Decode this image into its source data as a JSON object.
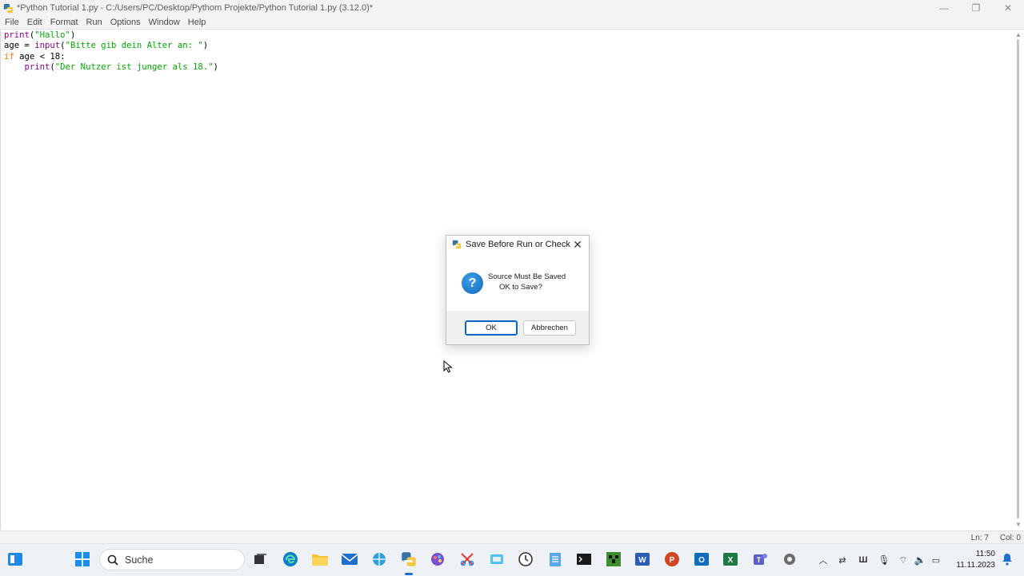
{
  "window": {
    "title": "*Python Tutorial 1.py - C:/Users/PC/Desktop/Pythom Projekte/Python Tutorial 1.py (3.12.0)*",
    "controls": {
      "minimize": "—",
      "restore": "❐",
      "close": "✕"
    }
  },
  "menu": {
    "items": [
      "File",
      "Edit",
      "Format",
      "Run",
      "Options",
      "Window",
      "Help"
    ]
  },
  "editor": {
    "lines": [
      [
        {
          "t": "print",
          "c": "bi"
        },
        {
          "t": "(",
          "c": ""
        },
        {
          "t": "\"Hallo\"",
          "c": "str"
        },
        {
          "t": ")",
          "c": ""
        }
      ],
      [
        {
          "t": "age = ",
          "c": ""
        },
        {
          "t": "input",
          "c": "bi"
        },
        {
          "t": "(",
          "c": ""
        },
        {
          "t": "\"Bitte gib dein Alter an: \"",
          "c": "str"
        },
        {
          "t": ")",
          "c": ""
        }
      ],
      [
        {
          "t": "if",
          "c": "kw"
        },
        {
          "t": " age < 18:",
          "c": ""
        }
      ],
      [
        {
          "t": "    ",
          "c": ""
        },
        {
          "t": "print",
          "c": "bi"
        },
        {
          "t": "(",
          "c": ""
        },
        {
          "t": "\"Der Nutzer ist junger als 18.\"",
          "c": "str"
        },
        {
          "t": ")",
          "c": ""
        }
      ]
    ]
  },
  "status": {
    "line": "Ln: 7",
    "col": "Col: 0"
  },
  "dialog": {
    "title": "Save Before Run or Check",
    "message_line1": "Source Must Be Saved",
    "message_line2": "OK to Save?",
    "ok_label": "OK",
    "cancel_label": "Abbrechen",
    "close_glyph": "✕",
    "question_glyph": "?"
  },
  "taskbar": {
    "search_label": "Suche",
    "time": "11:50",
    "date": "11.11.2023",
    "apps": [
      "task-view",
      "edge",
      "file-explorer",
      "mail",
      "vpn-globe",
      "python-idle",
      "paint",
      "snipping-tool",
      "screen-clip",
      "clock",
      "notepad",
      "terminal",
      "minecraft",
      "word",
      "powerpoint",
      "outlook",
      "excel",
      "teams",
      "settings"
    ]
  },
  "colors": {
    "keyword": "#ff7700",
    "builtin": "#900090",
    "string": "#00aa00",
    "accent": "#0a64c8"
  }
}
